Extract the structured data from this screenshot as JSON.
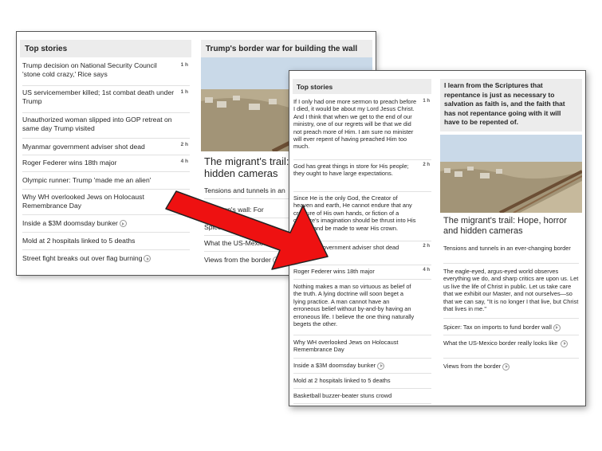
{
  "left_screenshot": {
    "top_stories_heading": "Top stories",
    "right_heading": "Trump's border war for building the wall",
    "stories": [
      {
        "text": "Trump decision on National Security Council 'stone cold crazy,' Rice says",
        "time": "1 h"
      },
      {
        "text": "US servicemember killed; 1st combat death under Trump",
        "time": "1 h"
      },
      {
        "text": "Unauthorized woman slipped into GOP retreat on same day Trump visited",
        "time": ""
      },
      {
        "text": "Myanmar adviser government shot dead",
        "time": "2 h"
      },
      {
        "text": "Roger Federer wins 18th major",
        "time": "4 h"
      },
      {
        "text": "Olympic runner: Trump 'made me an alien'",
        "time": ""
      },
      {
        "text": "Why WH overlooked Jews on Holocaust Remembrance Day",
        "time": ""
      },
      {
        "text": "Inside a $3M doomsday bunker",
        "time": ""
      },
      {
        "text": "Mold at 2 hospitals linked to 5 deaths",
        "time": ""
      },
      {
        "text": "Street fight breaks out over flag burning",
        "time": ""
      }
    ],
    "feature_headline": "The migrant's trail: H... hidden cameras",
    "side_links": [
      "Tensions and tunnels in an ...",
      "... Trump's wall: For ...",
      "Spicer: ...",
      "What the US-Mexico bord...",
      "Views from the border"
    ]
  },
  "right_screenshot": {
    "top_stories_heading": "Top stories",
    "quote": "I learn from the Scriptures that repentance is just as necessary to salvation as faith is, and the faith that has not repentance going with it will have to be repented of.",
    "stories": [
      {
        "text": "If I only had one more sermon to preach before I died, it would be about my Lord Jesus Christ. And I think that when we get to the end of our ministry, one of our regrets will be that we did not preach more of Him. I am sure no minister will ever repent of having preached Him too much.",
        "time": "1 h"
      },
      {
        "text": "God has great things in store for His people; they ought to have large expectations.",
        "time": "2 h"
      },
      {
        "text": "Since He is the only God, the Creator of heaven and earth, He cannot endure that any creature of His own hands, or fiction of a creature's imagination should be thrust into His throne, and be made to wear His crown.",
        "time": ""
      },
      {
        "text": "Myanmar government adviser shot dead",
        "time": "2 h"
      },
      {
        "text": "Roger Federer wins 18th major",
        "time": "4 h"
      },
      {
        "text": "Nothing makes a man so virtuous as belief of the truth. A lying doctrine will soon beget a lying practice. A man cannot have an erroneous belief without by-and-by having an erroneous life. I believe the one thing naturally begets the other.",
        "time": ""
      },
      {
        "text": "Why WH overlooked Jews on Holocaust Remembrance Day",
        "time": ""
      },
      {
        "text": "Inside a $3M doomsday bunker",
        "time": ""
      },
      {
        "text": "Mold at 2 hospitals linked to 5 deaths",
        "time": ""
      },
      {
        "text": "Basketball buzzer-beater stuns crowd",
        "time": ""
      }
    ],
    "feature_headline": "The migrant's trail: Hope, horror and hidden cameras",
    "side_links": [
      "Tensions and tunnels in an ever-changing border",
      "The eagle-eyed, argus-eyed world observes everything we do, and sharp critics are upon us. Let us live the life of Christ in public. Let us take care that we exhibit our Master, and not ourselves—so that we can say, \"It is no longer I that live, but Christ that lives in me.\"",
      "Spicer: Tax on imports to fund border wall",
      "What the US-Mexico border really looks like",
      "Views from the border"
    ]
  },
  "colors": {
    "arrow_fill": "#ee1111",
    "arrow_stroke": "#222222",
    "header_bg": "#ececec"
  }
}
